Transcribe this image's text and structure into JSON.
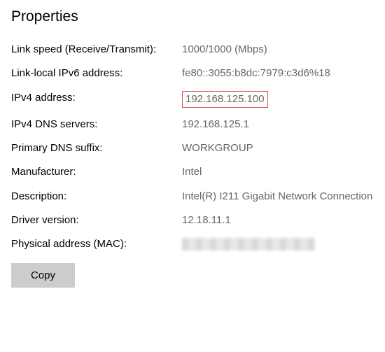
{
  "title": "Properties",
  "rows": {
    "link_speed": {
      "label": "Link speed (Receive/Transmit):",
      "value": "1000/1000 (Mbps)"
    },
    "ipv6": {
      "label": "Link-local IPv6 address:",
      "value": "fe80::3055:b8dc:7979:c3d6%18"
    },
    "ipv4": {
      "label": "IPv4 address:",
      "value": "192.168.125.100"
    },
    "dns": {
      "label": "IPv4 DNS servers:",
      "value": "192.168.125.1"
    },
    "dns_suffix": {
      "label": "Primary DNS suffix:",
      "value": "WORKGROUP"
    },
    "manufacturer": {
      "label": "Manufacturer:",
      "value": "Intel"
    },
    "description": {
      "label": "Description:",
      "value": "Intel(R) I211 Gigabit Network Connection"
    },
    "driver": {
      "label": "Driver version:",
      "value": "12.18.11.1"
    },
    "mac": {
      "label": "Physical address (MAC):",
      "value": ""
    }
  },
  "copy_label": "Copy"
}
